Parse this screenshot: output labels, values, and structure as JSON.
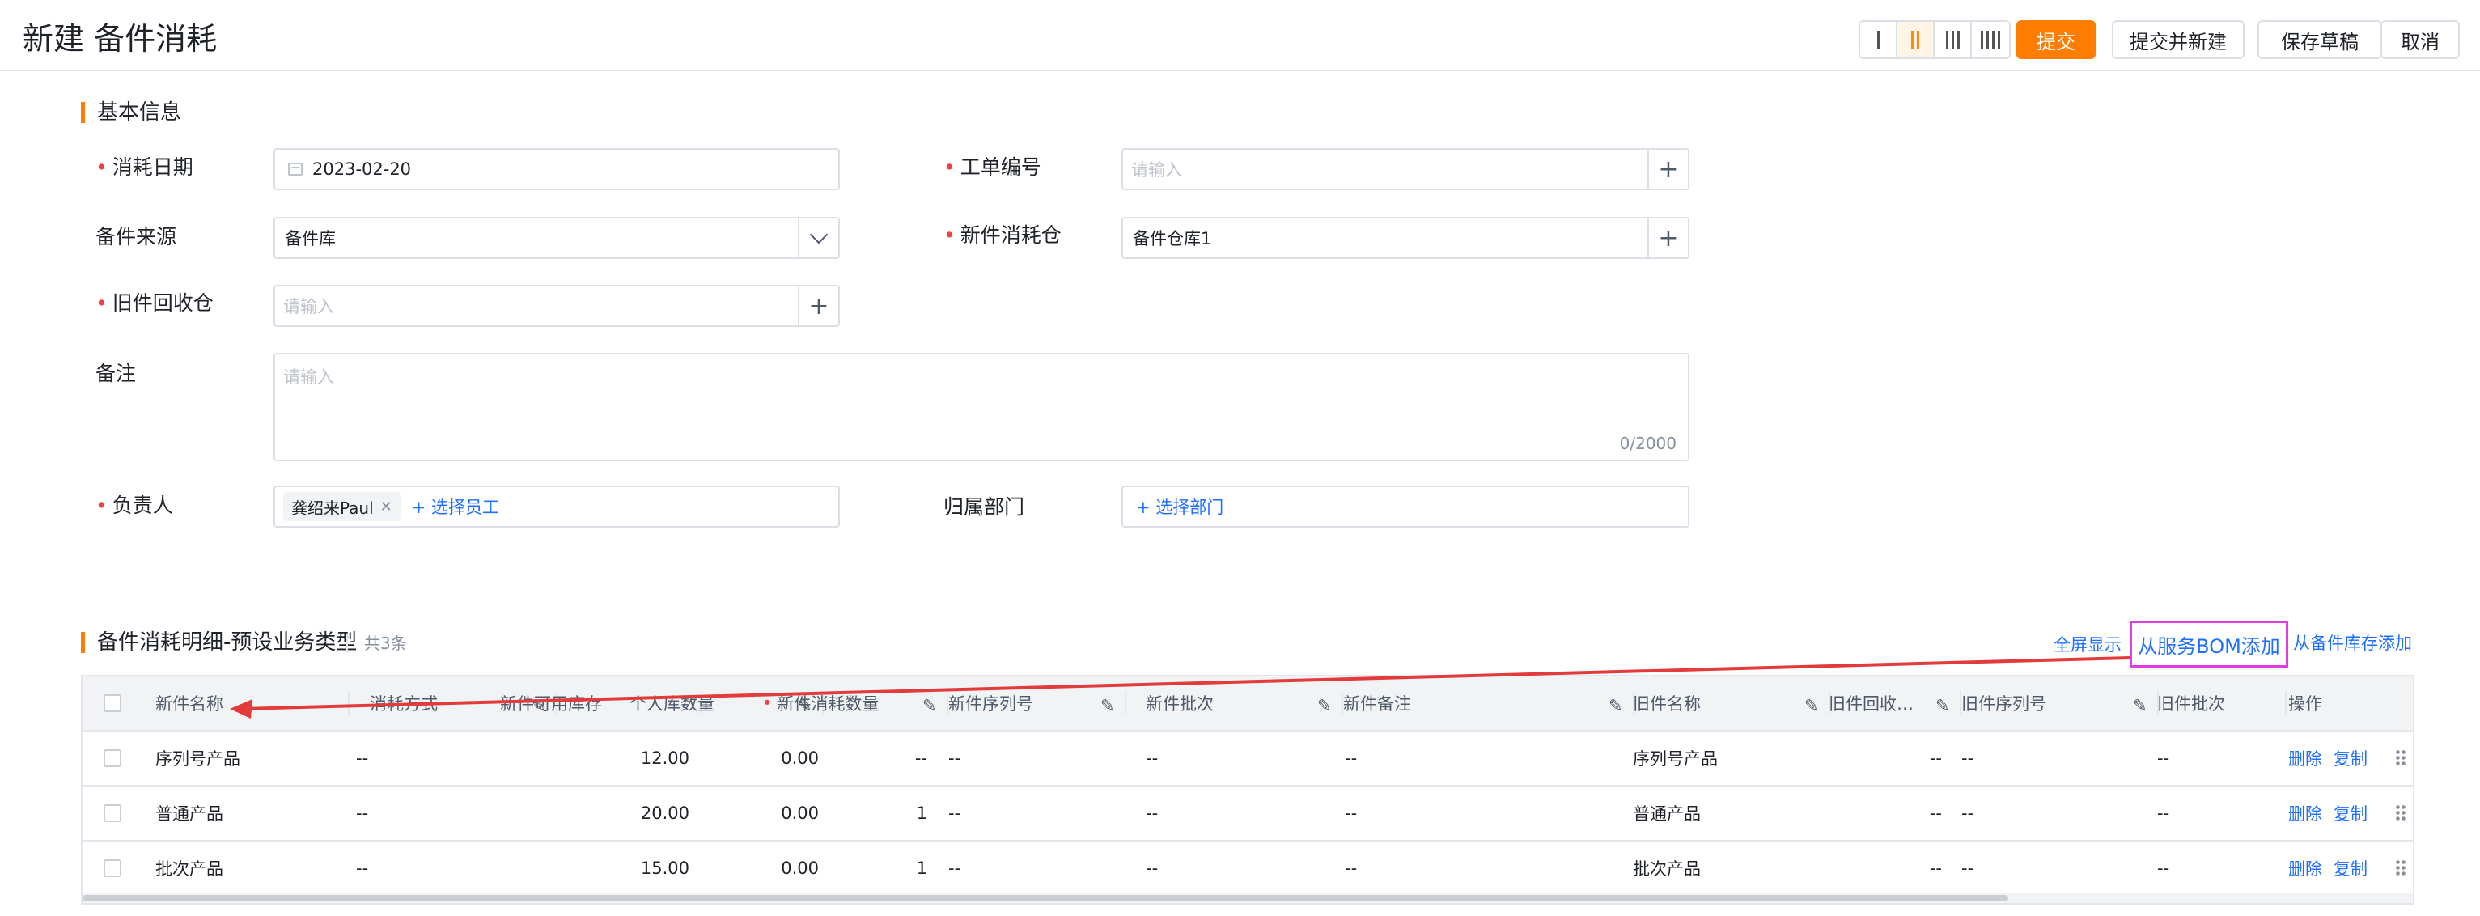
{
  "header": {
    "title": "新建 备件消耗",
    "layout_options": [
      "1-column",
      "2-column",
      "3-column",
      "4-column"
    ],
    "layout_selected": "2-column",
    "buttons": {
      "submit": "提交",
      "submit_new": "提交并新建",
      "save_draft": "保存草稿",
      "cancel": "取消"
    },
    "accent_color": "#ff7d00"
  },
  "basic_info": {
    "title": "基本信息",
    "consume_date": {
      "label": "消耗日期",
      "value": "2023-02-20"
    },
    "work_order": {
      "label": "工单编号",
      "placeholder": "请输入"
    },
    "source": {
      "label": "备件来源",
      "value": "备件库"
    },
    "new_warehouse": {
      "label": "新件消耗仓",
      "value": "备件仓库1"
    },
    "old_warehouse": {
      "label": "旧件回收仓",
      "placeholder": "请输入"
    },
    "remark": {
      "label": "备注",
      "placeholder": "请输入",
      "counter": "0/2000"
    },
    "owner": {
      "label": "负责人",
      "tag": "龚绍来Paul",
      "add_link": "+ 选择员工"
    },
    "department": {
      "label": "归属部门",
      "add_link": "+ 选择部门"
    }
  },
  "detail": {
    "title": "备件消耗明细-预设业务类型",
    "count": "共3条",
    "links": {
      "fullscreen": "全屏显示",
      "from_bom": "从服务BOM添加",
      "from_stock": "从备件库存添加"
    },
    "columns": [
      "新件名称",
      "消耗方式",
      "新件可用库存",
      "个人库数量",
      "新件消耗数量",
      "新件序列号",
      "新件批次",
      "新件备注",
      "旧件名称",
      "旧件回收…",
      "旧件序列号",
      "旧件批次",
      "操作"
    ],
    "rows": [
      {
        "name": "序列号产品",
        "mode": "--",
        "stock": "12.00",
        "personal": "0.00",
        "qty": "--",
        "serial": "--",
        "batch": "--",
        "note": "--",
        "old_name": "序列号产品",
        "old_recycle": "--",
        "old_serial": "--",
        "old_batch": "--"
      },
      {
        "name": "普通产品",
        "mode": "--",
        "stock": "20.00",
        "personal": "0.00",
        "qty": "1",
        "serial": "--",
        "batch": "--",
        "note": "--",
        "old_name": "普通产品",
        "old_recycle": "--",
        "old_serial": "--",
        "old_batch": "--"
      },
      {
        "name": "批次产品",
        "mode": "--",
        "stock": "15.00",
        "personal": "0.00",
        "qty": "1",
        "serial": "--",
        "batch": "--",
        "note": "--",
        "old_name": "批次产品",
        "old_recycle": "--",
        "old_serial": "--",
        "old_batch": "--"
      }
    ],
    "row_actions": {
      "delete": "删除",
      "copy": "复制"
    }
  }
}
